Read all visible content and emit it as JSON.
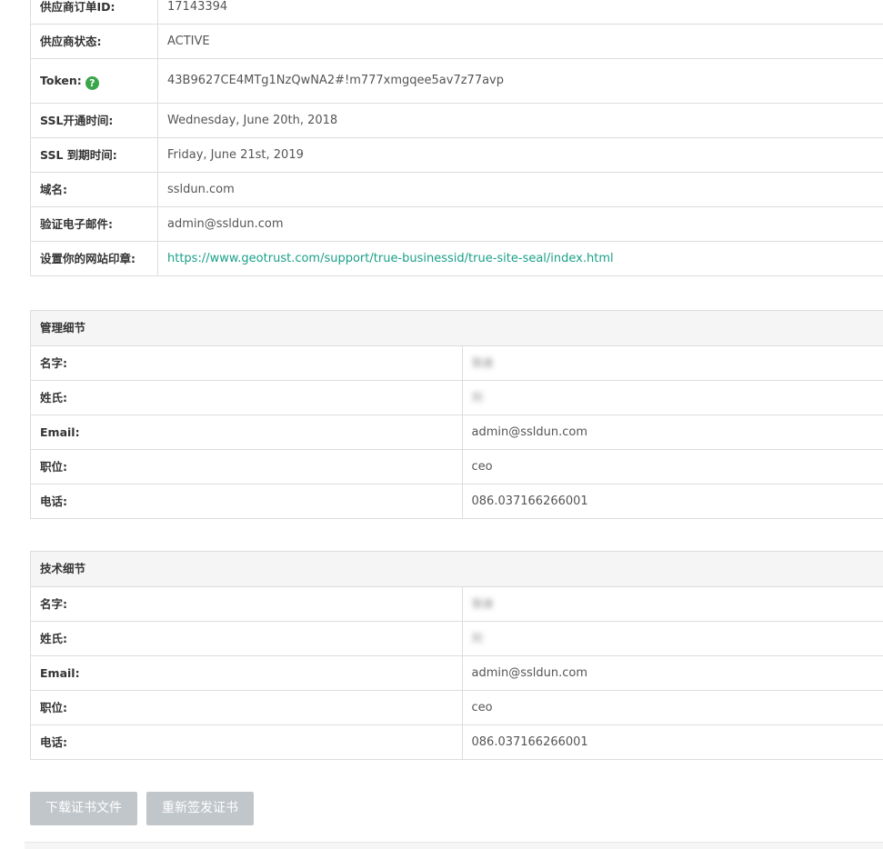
{
  "order": {
    "rows": [
      {
        "label": "供应商订单ID:",
        "value": "17143394"
      },
      {
        "label": "供应商状态:",
        "value": "ACTIVE"
      },
      {
        "label": "Token:",
        "value": "43B9627CE4MTg1NzQwNA2#!m777xmgqee5av7z77avp",
        "help_icon": "?"
      },
      {
        "label": "SSL开通时间:",
        "value": "Wednesday, June 20th, 2018"
      },
      {
        "label": "SSL 到期时间:",
        "value": "Friday, June 21st, 2019"
      },
      {
        "label": "域名:",
        "value": "ssldun.com"
      },
      {
        "label": "验证电子邮件:",
        "value": "admin@ssldun.com"
      },
      {
        "label": "设置你的网站印章:",
        "value": "https://www.geotrust.com/support/true-businessid/true-site-seal/index.html"
      }
    ]
  },
  "admin": {
    "title": "管理细节",
    "rows": [
      {
        "label": "名字:",
        "value": "张迪"
      },
      {
        "label": "姓氏:",
        "value": "刘"
      },
      {
        "label": "Email:",
        "value": "admin@ssldun.com"
      },
      {
        "label": "职位:",
        "value": "ceo"
      },
      {
        "label": "电话:",
        "value": "086.037166266001"
      }
    ]
  },
  "tech": {
    "title": "技术细节",
    "rows": [
      {
        "label": "名字:",
        "value": "张迪"
      },
      {
        "label": "姓氏:",
        "value": "刘"
      },
      {
        "label": "Email:",
        "value": "admin@ssldun.com"
      },
      {
        "label": "职位:",
        "value": "ceo"
      },
      {
        "label": "电话:",
        "value": "086.037166266001"
      }
    ]
  },
  "buttons": {
    "download": "下载证书文件",
    "reissue": "重新签发证书"
  },
  "colors": {
    "link": "#1aa089",
    "help_icon": "#3aa64a",
    "button_disabled": "#c1c6ca",
    "header_bg": "#f5f5f5",
    "border": "#dddddd"
  }
}
